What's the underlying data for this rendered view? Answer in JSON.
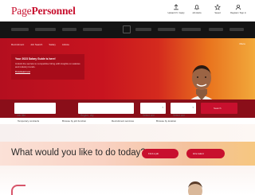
{
  "header": {
    "logo_part1": "Page",
    "logo_part2": "Personnel",
    "icons": [
      {
        "label": "Upload CV / Apply",
        "icon": "upload-icon"
      },
      {
        "label": "Job Alerts",
        "icon": "bell-icon"
      },
      {
        "label": "Saved",
        "icon": "star-icon"
      },
      {
        "label": "Register / Sign in",
        "icon": "user-icon"
      }
    ]
  },
  "subnav": {
    "items": [
      "Recruitment",
      "Job Search",
      "Salary",
      "Advice"
    ],
    "right_label": "Menu"
  },
  "promo": {
    "title": "Your 2023 Salary Guide is here!",
    "text": "Unlock the secrets to competitive hiring with insights on salaries and industry trends.",
    "link": "Download now"
  },
  "search": {
    "keyword_placeholder": "Job title",
    "location_placeholder": "Region, city",
    "sector_placeholder": "Select one",
    "jobtype_placeholder": "Select one",
    "button_label": "Search"
  },
  "quick_links": [
    "Temporary contracts",
    "Browse by job function",
    "Recruitment services",
    "Browse by location"
  ],
  "question": {
    "title": "What would you like to do today?",
    "btn1": "Find a job",
    "btn2": "Hire talent"
  },
  "colors": {
    "brand": "#c8102e",
    "dark_nav": "#141414",
    "accent_orange": "#f2a93b"
  }
}
